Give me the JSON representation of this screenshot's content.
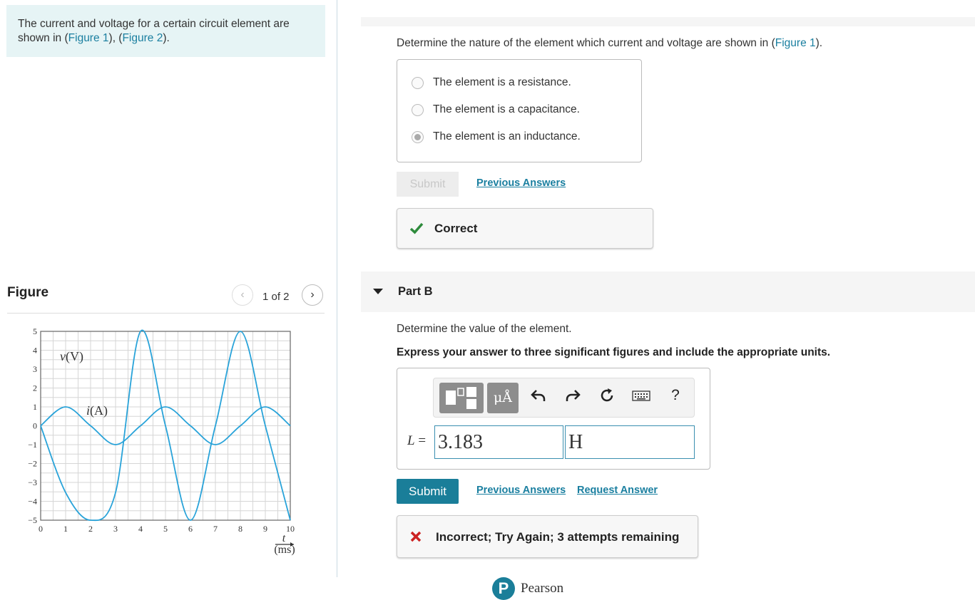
{
  "intro": {
    "text_before": "The current and voltage for a certain circuit element are shown in (",
    "link1": "Figure 1",
    "text_mid": "), (",
    "link2": "Figure 2",
    "text_after": ")."
  },
  "figure_panel": {
    "title": "Figure",
    "prev_icon": "chevron-left-icon",
    "next_icon": "chevron-right-icon",
    "counter": "1 of 2"
  },
  "part_a": {
    "question_before": "Determine the nature of the element which current and voltage are shown in (",
    "question_link": "Figure 1",
    "question_after": ").",
    "choices": [
      {
        "label": "The element is a resistance.",
        "selected": false
      },
      {
        "label": "The element is a capacitance.",
        "selected": false
      },
      {
        "label": "The element is an inductance.",
        "selected": true
      }
    ],
    "submit_label": "Submit",
    "previous_answers": "Previous Answers",
    "feedback": "Correct",
    "feedback_color": "#2e8b3c"
  },
  "part_b": {
    "title": "Part B",
    "prompt": "Determine the value of the element.",
    "instruction": "Express your answer to three significant figures and include the appropriate units.",
    "toolbar": {
      "template_icon": "templates-icon",
      "units_label": "μÅ",
      "undo_icon": "undo-icon",
      "redo_icon": "redo-icon",
      "reset_icon": "reset-icon",
      "keyboard_icon": "keyboard-icon",
      "help_label": "?"
    },
    "variable": "L",
    "equals": "=",
    "value": "3.183",
    "unit": "H",
    "submit_label": "Submit",
    "previous_answers": "Previous Answers",
    "request_answer": "Request Answer",
    "feedback": "Incorrect; Try Again; 3 attempts remaining",
    "feedback_color": "#cc2222"
  },
  "footer": {
    "brand": "Pearson"
  },
  "chart_data": {
    "type": "line",
    "x": [
      0,
      1,
      2,
      3,
      4,
      5,
      6,
      7,
      8,
      9,
      10
    ],
    "x_tick_labels": [
      "0",
      "1",
      "2",
      "3",
      "4",
      "5",
      "6",
      "7",
      "8",
      "9",
      "10"
    ],
    "y_tick_labels": [
      "5",
      "4",
      "3",
      "2",
      "1",
      "0",
      "−1",
      "−2",
      "−3",
      "−4",
      "−5"
    ],
    "xlim": [
      0,
      10
    ],
    "ylim": [
      -5,
      5
    ],
    "grid": true,
    "xlabel_top": "t",
    "xlabel_bottom": "(ms)",
    "series": [
      {
        "name": "v(V)",
        "label_italic": "v",
        "label_rest": "(V)",
        "points": [
          [
            0,
            0
          ],
          [
            1,
            -3.5355
          ],
          [
            2,
            -5
          ],
          [
            3,
            -3.5355
          ],
          [
            4,
            5
          ],
          [
            5,
            0
          ],
          [
            6,
            -5
          ],
          [
            7,
            0
          ],
          [
            8,
            5
          ],
          [
            9,
            0
          ],
          [
            10,
            -5
          ]
        ],
        "color": "#29a3d9"
      },
      {
        "name": "i(A)",
        "label_italic": "i",
        "label_rest": "(A)",
        "points": [
          [
            0,
            0
          ],
          [
            1,
            1
          ],
          [
            2,
            0
          ],
          [
            3,
            -1
          ],
          [
            4,
            0
          ],
          [
            5,
            1
          ],
          [
            6,
            0
          ],
          [
            7,
            -1
          ],
          [
            8,
            0
          ],
          [
            9,
            1
          ],
          [
            10,
            0
          ]
        ],
        "color": "#29a3d9"
      }
    ]
  }
}
